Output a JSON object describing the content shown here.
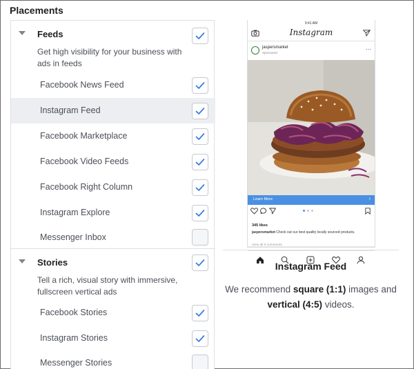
{
  "page_title": "Placements",
  "sections": [
    {
      "label": "Feeds",
      "checked": true,
      "description": "Get high visibility for your business with ads in feeds",
      "items": [
        {
          "label": "Facebook News Feed",
          "checked": true
        },
        {
          "label": "Instagram Feed",
          "checked": true,
          "highlighted": true
        },
        {
          "label": "Facebook Marketplace",
          "checked": true
        },
        {
          "label": "Facebook Video Feeds",
          "checked": true
        },
        {
          "label": "Facebook Right Column",
          "checked": true
        },
        {
          "label": "Instagram Explore",
          "checked": true
        },
        {
          "label": "Messenger Inbox",
          "checked": false
        }
      ]
    },
    {
      "label": "Stories",
      "checked": true,
      "description": "Tell a rich, visual story with immersive, fullscreen vertical ads",
      "items": [
        {
          "label": "Facebook Stories",
          "checked": true
        },
        {
          "label": "Instagram Stories",
          "checked": true
        },
        {
          "label": "Messenger Stories",
          "checked": false
        }
      ]
    }
  ],
  "preview": {
    "phone": {
      "status_time": "9:41 AM",
      "brand": "Instagram",
      "account": "jaspersmarket",
      "sponsored": "Sponsored",
      "cta": "Learn More",
      "likes": "345 likes",
      "caption_account": "jaspersmarket",
      "caption_text": " Check out our best quality locally sourced products.",
      "comments": "View all 9 comments"
    },
    "title": "Instagram Feed",
    "desc_part1": "We recommend ",
    "desc_bold1": "square (1:1)",
    "desc_part2": " images and ",
    "desc_bold2": "vertical (4:5)",
    "desc_part3": " videos."
  },
  "colors": {
    "check": "#3578e5",
    "highlight_row": "#eceef1",
    "cta_bar": "#4a90e2"
  },
  "icons": [
    "caret-down-icon",
    "checkmark-icon",
    "camera-icon",
    "send-icon",
    "heart-icon",
    "comment-icon",
    "share-icon",
    "bookmark-icon",
    "home-icon",
    "search-icon",
    "add-icon",
    "profile-icon"
  ]
}
